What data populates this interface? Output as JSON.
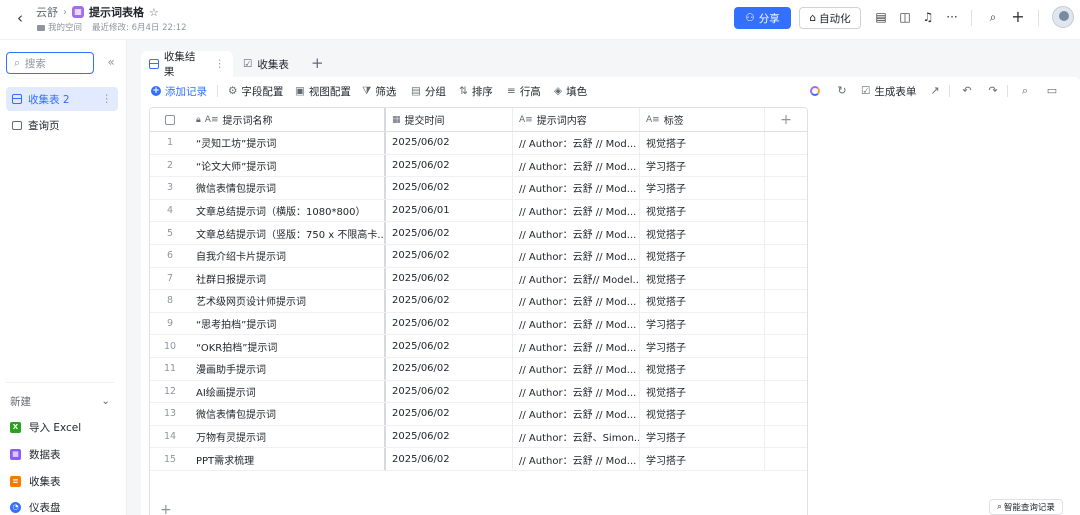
{
  "header": {
    "parent": "云舒",
    "title": "提示词表格",
    "space": "我的空间",
    "modified": "最近修改: 6月4日 22:12",
    "share_label": "分享",
    "automation_label": "自动化"
  },
  "sidebar": {
    "search_placeholder": "搜索",
    "items": [
      {
        "label": "收集表 2",
        "active": true
      },
      {
        "label": "查询页",
        "active": false
      }
    ],
    "new_label": "新建",
    "create_items": [
      {
        "label": "导入 Excel",
        "icon": "excel-icon",
        "color": "#2ea121"
      },
      {
        "label": "数据表",
        "icon": "table-icon",
        "color": "#8a5cf5"
      },
      {
        "label": "收集表",
        "icon": "form-icon",
        "color": "#f57c00"
      },
      {
        "label": "仪表盘",
        "icon": "dashboard-icon",
        "color": "#3370ff"
      }
    ]
  },
  "tabs": [
    {
      "label": "收集结果",
      "active": true
    },
    {
      "label": "收集表",
      "active": false
    }
  ],
  "toolbar": {
    "add_record": "添加记录",
    "field_config": "字段配置",
    "view_config": "视图配置",
    "filter": "筛选",
    "group": "分组",
    "sort": "排序",
    "row_height": "行高",
    "fill_color": "填色",
    "generate_form": "生成表单"
  },
  "table": {
    "columns": [
      "提示词名称",
      "提交时间",
      "提示词内容",
      "标签"
    ],
    "rows": [
      {
        "num": "1",
        "name": "“灵知工坊”提示词",
        "date": "2025/06/02",
        "content": "// Author：云舒 // Mod...",
        "tag": "视觉搭子"
      },
      {
        "num": "2",
        "name": "“论文大师”提示词",
        "date": "2025/06/02",
        "content": "// Author：云舒 // Mod...",
        "tag": "学习搭子"
      },
      {
        "num": "3",
        "name": "微信表情包提示词",
        "date": "2025/06/02",
        "content": "// Author：云舒 // Mod...",
        "tag": "学习搭子"
      },
      {
        "num": "4",
        "name": "文章总结提示词（横版：1080*800）",
        "date": "2025/06/01",
        "content": "// Author：云舒 // Mod...",
        "tag": "视觉搭子"
      },
      {
        "num": "5",
        "name": "文章总结提示词（竖版：750 x 不限高卡...",
        "date": "2025/06/02",
        "content": "// Author：云舒 // Mod...",
        "tag": "视觉搭子"
      },
      {
        "num": "6",
        "name": "自我介绍卡片提示词",
        "date": "2025/06/02",
        "content": "// Author：云舒 // Mod...",
        "tag": "视觉搭子"
      },
      {
        "num": "7",
        "name": "社群日报提示词",
        "date": "2025/06/02",
        "content": "// Author：云舒// Model...",
        "tag": "视觉搭子"
      },
      {
        "num": "8",
        "name": "艺术级网页设计师提示词",
        "date": "2025/06/02",
        "content": "// Author：云舒 // Mod...",
        "tag": "视觉搭子"
      },
      {
        "num": "9",
        "name": "“思考拍档”提示词",
        "date": "2025/06/02",
        "content": "// Author：云舒 // Mod...",
        "tag": "学习搭子"
      },
      {
        "num": "10",
        "name": "“OKR拍档”提示词",
        "date": "2025/06/02",
        "content": "// Author：云舒 // Mod...",
        "tag": "学习搭子"
      },
      {
        "num": "11",
        "name": "漫画助手提示词",
        "date": "2025/06/02",
        "content": "// Author：云舒 // Mod...",
        "tag": "视觉搭子"
      },
      {
        "num": "12",
        "name": "AI绘画提示词",
        "date": "2025/06/02",
        "content": "// Author：云舒 // Mod...",
        "tag": "视觉搭子"
      },
      {
        "num": "13",
        "name": "微信表情包提示词",
        "date": "2025/06/02",
        "content": "// Author：云舒 // Mod...",
        "tag": "视觉搭子"
      },
      {
        "num": "14",
        "name": "万物有灵提示词",
        "date": "2025/06/02",
        "content": "// Author：云舒、Simon...",
        "tag": "学习搭子"
      },
      {
        "num": "15",
        "name": "PPT需求梳理",
        "date": "2025/06/02",
        "content": "// Author：云舒 // Mod...",
        "tag": "学习搭子"
      }
    ]
  },
  "smart_query": "智能查询记录",
  "colors": {
    "accent": "#3370ff",
    "active_bg": "#e1eaff"
  }
}
